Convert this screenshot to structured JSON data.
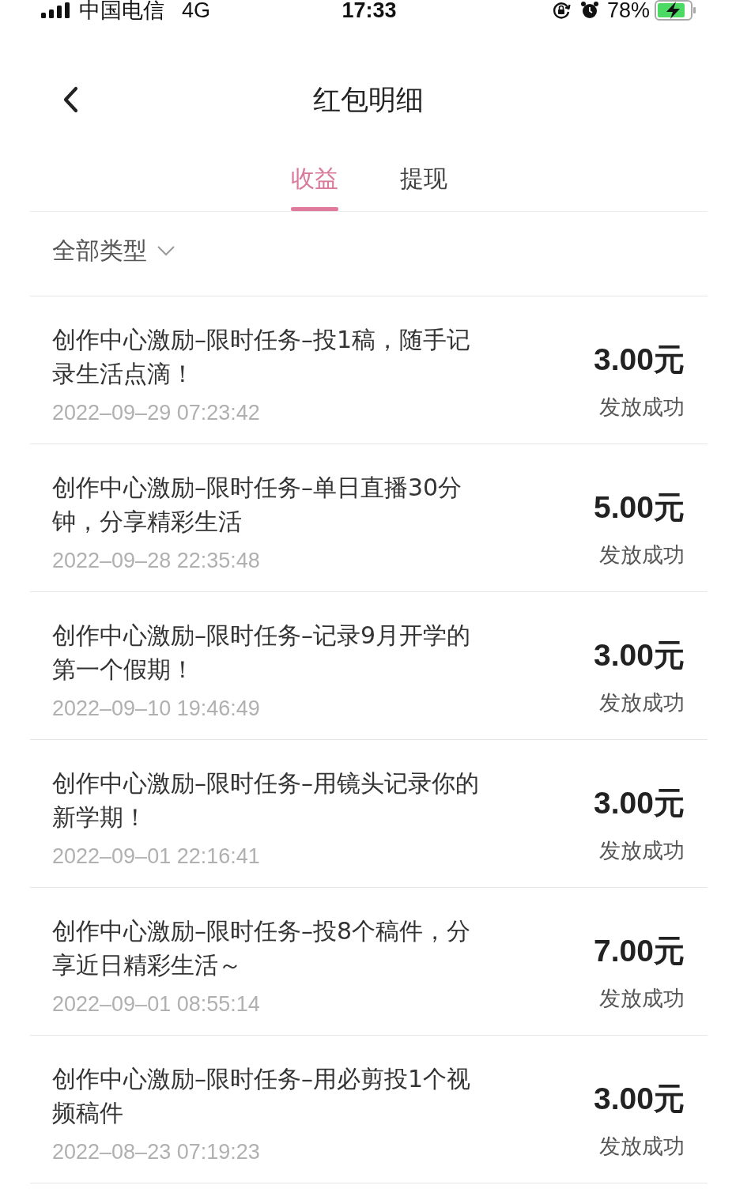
{
  "status_bar": {
    "carrier": "中国电信",
    "network": "4G",
    "time": "17:33",
    "battery": "78%"
  },
  "header": {
    "title": "红包明细"
  },
  "tabs": [
    {
      "label": "收益",
      "selected": true
    },
    {
      "label": "提现",
      "selected": false
    }
  ],
  "filter": {
    "label": "全部类型"
  },
  "records": [
    {
      "title": "创作中心激励–限时任务–投1稿，随手记录生活点滴！",
      "time": "2022–09–29 07:23:42",
      "amount": "3.00元",
      "status": "发放成功"
    },
    {
      "title": "创作中心激励–限时任务–单日直播30分钟，分享精彩生活",
      "time": "2022–09–28 22:35:48",
      "amount": "5.00元",
      "status": "发放成功"
    },
    {
      "title": "创作中心激励–限时任务–记录9月开学的第一个假期！",
      "time": "2022–09–10 19:46:49",
      "amount": "3.00元",
      "status": "发放成功"
    },
    {
      "title": "创作中心激励–限时任务–用镜头记录你的新学期！",
      "time": "2022–09–01 22:16:41",
      "amount": "3.00元",
      "status": "发放成功"
    },
    {
      "title": "创作中心激励–限时任务–投8个稿件，分享近日精彩生活～",
      "time": "2022–09–01 08:55:14",
      "amount": "7.00元",
      "status": "发放成功"
    },
    {
      "title": "创作中心激励–限时任务–用必剪投1个视频稿件",
      "time": "2022–08–23 07:19:23",
      "amount": "3.00元",
      "status": "发放成功"
    }
  ]
}
